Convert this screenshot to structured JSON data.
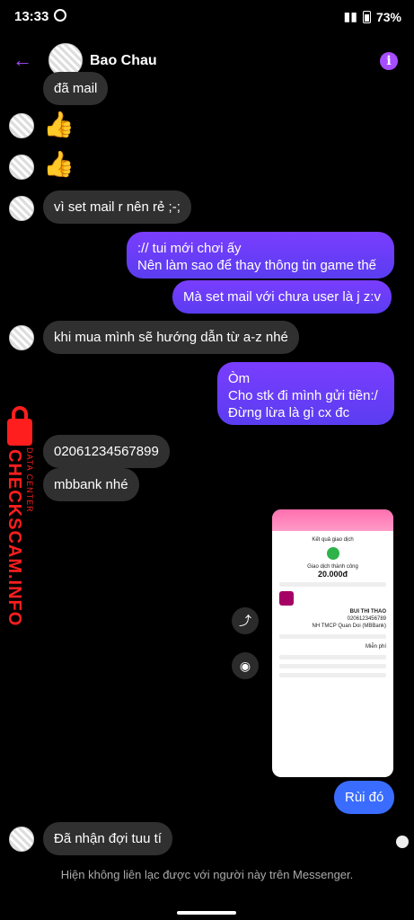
{
  "status_bar": {
    "time": "13:33",
    "battery": "73%"
  },
  "header": {
    "name": "Bao Chau",
    "back_icon": "arrow-left-icon",
    "info_icon": "info-icon"
  },
  "messages": {
    "m0": "đã mail",
    "m1": "vì set mail r nên rẻ ;-;",
    "m2_line1": ":// tui mới chơi ấy",
    "m2_line2": "Nên làm sao để thay thông tin game thế",
    "m3": "Mà set mail với chưa user là j z:v",
    "m4": "khi mua mình sẽ hướng dẫn từ a-z nhé",
    "m5_line1": "Òm",
    "m5_line2": "Cho stk đi mình gửi tiền:/",
    "m5_line3": "Đừng lừa là gì cx đc",
    "m6": "02061234567899",
    "m7": "mbbank nhé",
    "m8": "Rùi đó",
    "m9": "Đã nhận đợi tuu tí"
  },
  "screenshot_receipt": {
    "title": "Kết quả giao dịch",
    "status": "Giao dịch thành công",
    "amount": "20.000đ",
    "recipient": "BUI THI THAO",
    "account": "0206123456789",
    "bank": "NH TMCP Quan Doi (MBBank)",
    "fee": "Miễn phí"
  },
  "footer": {
    "note": "Hiện không liên lạc được với người này trên Messenger."
  },
  "watermark": {
    "brand": "CHECKSCAM.INFO",
    "sub": "DATA CENTER"
  }
}
